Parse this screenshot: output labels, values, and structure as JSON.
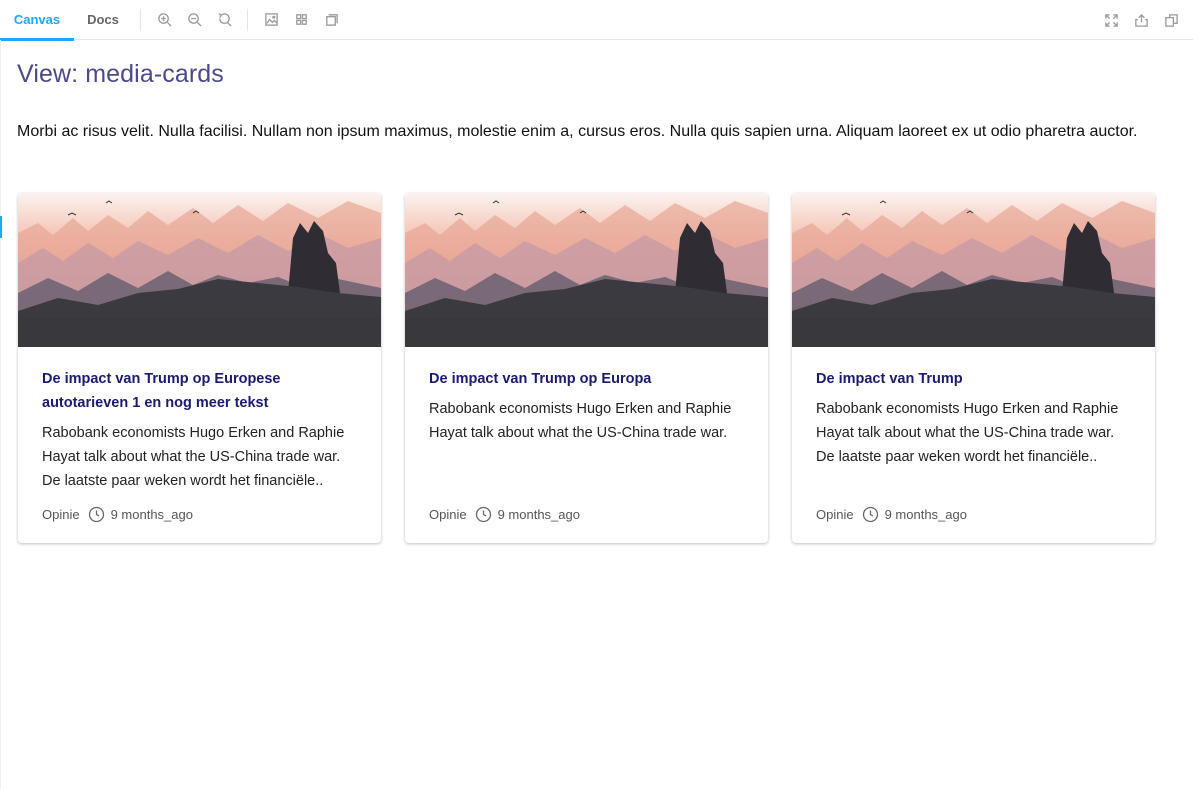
{
  "toolbar": {
    "tabs": [
      {
        "label": "Canvas",
        "active": true
      },
      {
        "label": "Docs",
        "active": false
      }
    ],
    "tools": [
      "zoom-in-icon",
      "zoom-out-icon",
      "zoom-reset-icon",
      "background-icon",
      "grid-icon",
      "outline-icon"
    ],
    "right_tools": [
      "fullscreen-icon",
      "share-icon",
      "copy-icon"
    ],
    "accent_color": "#1ea7fd"
  },
  "page": {
    "title": "View: media-cards",
    "intro": "Morbi ac risus velit. Nulla facilisi. Nullam non ipsum maximus, molestie enim a, cursus eros. Nulla quis sapien urna. Aliquam laoreet ex ut odio pharetra auctor."
  },
  "cards": [
    {
      "title": "De impact van Trump op Europese autotarieven 1 en nog meer tekst",
      "text": "Rabobank economists Hugo Erken and Raphie Hayat talk about what the US-China trade war. De laatste paar weken wordt het financiële..",
      "category": "Opinie",
      "time": "9 months_ago"
    },
    {
      "title": "De impact van Trump op Europa",
      "text": "Rabobank economists Hugo Erken and Raphie Hayat talk about what the US-China trade war.",
      "category": "Opinie",
      "time": "9 months_ago"
    },
    {
      "title": "De impact van Trump",
      "text": "Rabobank economists Hugo Erken and Raphie Hayat talk about what the US-China trade war. De laatste paar weken wordt het financiële..",
      "category": "Opinie",
      "time": "9 months_ago"
    }
  ]
}
